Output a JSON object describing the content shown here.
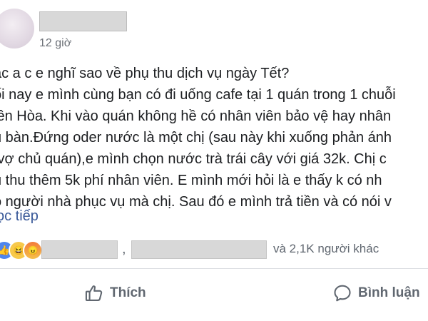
{
  "post": {
    "time": "12 giờ",
    "lines": [
      "ác a c e nghĩ sao về phụ thu dịch vụ ngày Tết?",
      "ối nay e mình cùng bạn có đi uống cafe tại 1 quán trong 1 chuỗi",
      "iên Hòa. Khi vào quán không hề có nhân viên bảo vệ hay nhân",
      "ụ bàn.Đứng oder nước là một chị (sau này khi xuống phản ánh",
      " vợ chủ quán),e mình chọn nước trà trái cây với giá 32k. Chị c",
      "ụ thu thêm 5k phí nhân viên. E mình mới hỏi là e thấy k có nh",
      "ó người nhà phục vụ mà chị. Sau đó e mình trả tiền và có nói v"
    ],
    "see_more": "ọc tiếp"
  },
  "reactions": {
    "separator": ",",
    "others": "và 2,1K người khác",
    "types": [
      "like",
      "haha",
      "angry"
    ]
  },
  "actions": {
    "like_label": "Thích",
    "comment_label": "Bình luận"
  },
  "icons": {
    "like": "thumbs-up-icon",
    "comment": "speech-bubble-icon"
  }
}
